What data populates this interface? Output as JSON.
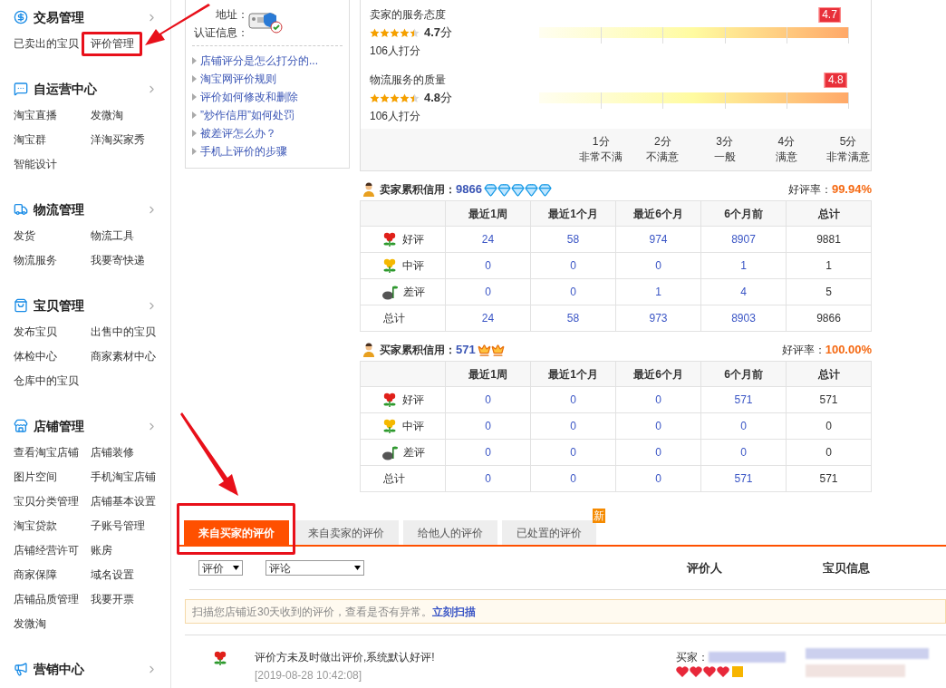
{
  "sidebar": {
    "sections": [
      {
        "title": "交易管理",
        "items": [
          "已卖出的宝贝",
          "评价管理"
        ]
      },
      {
        "title": "自运营中心",
        "items": [
          "淘宝直播",
          "发微淘",
          "淘宝群",
          "洋淘买家秀",
          "智能设计"
        ]
      },
      {
        "title": "物流管理",
        "items": [
          "发货",
          "物流工具",
          "物流服务",
          "我要寄快递"
        ]
      },
      {
        "title": "宝贝管理",
        "items": [
          "发布宝贝",
          "出售中的宝贝",
          "体检中心",
          "商家素材中心",
          "仓库中的宝贝"
        ]
      },
      {
        "title": "店铺管理",
        "items": [
          "查看淘宝店铺",
          "店铺装修",
          "图片空间",
          "手机淘宝店铺",
          "宝贝分类管理",
          "店铺基本设置",
          "淘宝贷款",
          "子账号管理",
          "店铺经营许可",
          "账房",
          "商家保障",
          "域名设置",
          "店铺品质管理",
          "我要开票",
          "发微淘"
        ]
      },
      {
        "title": "营销中心"
      }
    ]
  },
  "info_box": {
    "address_label": "地址：",
    "cert_label": "认证信息：",
    "links": [
      "店铺评分是怎么打分的...",
      "淘宝网评价规则",
      "评价如何修改和删除",
      "”炒作信用”如何处罚",
      "被差评怎么办？",
      "手机上评价的步骤"
    ]
  },
  "ratings": {
    "items": [
      {
        "title": "卖家的服务态度",
        "stars": 4.5,
        "score": "**4.7**分",
        "count": "106人打分",
        "marker": "4.7",
        "level": 0.94
      },
      {
        "title": "物流服务的质量",
        "stars": 4.5,
        "score": "**4.8**分",
        "count": "106人打分",
        "marker": "4.8",
        "level": 0.96
      }
    ],
    "scale": [
      {
        "score": "1分",
        "label": "非常不满"
      },
      {
        "score": "2分",
        "label": "不满意"
      },
      {
        "score": "3分",
        "label": "一般"
      },
      {
        "score": "4分",
        "label": "满意"
      },
      {
        "score": "5分",
        "label": "非常满意"
      }
    ]
  },
  "credits": [
    {
      "title": "卖家累积信用：",
      "score": "9866",
      "badges": [
        {
          "kind": "diamond"
        },
        {
          "kind": "diamond"
        },
        {
          "kind": "diamond"
        },
        {
          "kind": "diamond"
        },
        {
          "kind": "diamond"
        }
      ],
      "rate_label": "好评率：",
      "rate": "99.94%",
      "columns": [
        "最近1周",
        "最近1个月",
        "最近6个月",
        "6个月前",
        "总计"
      ],
      "rows": [
        {
          "kind": "good",
          "label": "好评",
          "cells": [
            "24",
            "58",
            "974",
            "8907",
            "9881"
          ]
        },
        {
          "kind": "neutral",
          "label": "中评",
          "cells": [
            "0",
            "0",
            "0",
            "1",
            "1"
          ]
        },
        {
          "kind": "bad",
          "label": "差评",
          "cells": [
            "0",
            "0",
            "1",
            "4",
            "5"
          ]
        },
        {
          "kind": "total",
          "label": "总计",
          "cells": [
            "24",
            "58",
            "973",
            "8903",
            "9866"
          ]
        }
      ]
    },
    {
      "title": "买家累积信用：",
      "score": "571",
      "badges": [
        {
          "kind": "crown"
        },
        {
          "kind": "crown"
        }
      ],
      "rate_label": "好评率：",
      "rate": "100.00%",
      "columns": [
        "最近1周",
        "最近1个月",
        "最近6个月",
        "6个月前",
        "总计"
      ],
      "rows": [
        {
          "kind": "good",
          "label": "好评",
          "cells": [
            "0",
            "0",
            "0",
            "571",
            "571"
          ]
        },
        {
          "kind": "neutral",
          "label": "中评",
          "cells": [
            "0",
            "0",
            "0",
            "0",
            "0"
          ]
        },
        {
          "kind": "bad",
          "label": "差评",
          "cells": [
            "0",
            "0",
            "0",
            "0",
            "0"
          ]
        },
        {
          "kind": "total",
          "label": "总计",
          "cells": [
            "0",
            "0",
            "0",
            "571",
            "571"
          ]
        }
      ]
    }
  ],
  "tabs": [
    {
      "label": "来自买家的评价",
      "selected": true
    },
    {
      "label": "来自卖家的评价",
      "selected": false
    },
    {
      "label": "给他人的评价",
      "selected": false
    },
    {
      "label": "已处置的评价",
      "selected": false,
      "badge": "新"
    }
  ],
  "filters": {
    "rating": "评价",
    "comment": "评论",
    "headers": [
      "评价人",
      "宝贝信息"
    ]
  },
  "notice": {
    "text": "扫描您店铺近30天收到的评价，查看是否有异常。",
    "link": "立刻扫描"
  },
  "review": {
    "kind": "good",
    "comment": "评价方未及时做出评价,系统默认好评!",
    "time": "[2019-08-28 10:42:08]",
    "buyer_label": "买家："
  }
}
